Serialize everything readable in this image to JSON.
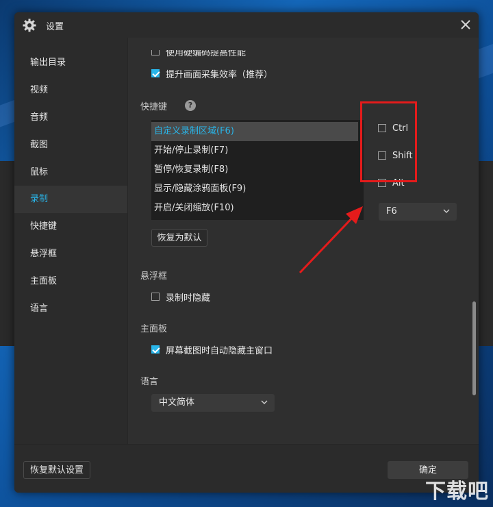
{
  "window": {
    "title": "设置",
    "close_icon": "close-icon",
    "title_icon": "gear-icon"
  },
  "sidebar": {
    "items": [
      {
        "label": "输出目录",
        "active": false
      },
      {
        "label": "视频",
        "active": false
      },
      {
        "label": "音频",
        "active": false
      },
      {
        "label": "截图",
        "active": false
      },
      {
        "label": "鼠标",
        "active": false
      },
      {
        "label": "录制",
        "active": true
      },
      {
        "label": "快捷键",
        "active": false
      },
      {
        "label": "悬浮框",
        "active": false
      },
      {
        "label": "主面板",
        "active": false
      },
      {
        "label": "语言",
        "active": false
      }
    ]
  },
  "recording": {
    "hw_encode_label": "使用硬编码提高性能",
    "hw_encode_checked": false,
    "capture_eff_label": "提升画面采集效率（推荐）",
    "capture_eff_checked": true
  },
  "hotkeys": {
    "section_title": "快捷键",
    "help_icon": "?",
    "items": [
      {
        "label": "自定义录制区域(F6)",
        "selected": true
      },
      {
        "label": "开始/停止录制(F7)",
        "selected": false
      },
      {
        "label": "暂停/恢复录制(F8)",
        "selected": false
      },
      {
        "label": "显示/隐藏涂鸦面板(F9)",
        "selected": false
      },
      {
        "label": "开启/关闭缩放(F10)",
        "selected": false
      }
    ],
    "modifiers": [
      {
        "label": "Ctrl",
        "checked": false
      },
      {
        "label": "Shift",
        "checked": false
      },
      {
        "label": "Alt",
        "checked": false
      }
    ],
    "key_value": "F6",
    "reset_label": "恢复为默认"
  },
  "floating": {
    "section_title": "悬浮框",
    "hide_label": "录制时隐藏",
    "hide_checked": false
  },
  "main_panel": {
    "section_title": "主面板",
    "auto_hide_label": "屏幕截图时自动隐藏主窗口",
    "auto_hide_checked": true
  },
  "language": {
    "section_title": "语言",
    "value": "中文简体"
  },
  "footer": {
    "reset_all_label": "恢复默认设置",
    "ok_label": "确定"
  },
  "colors": {
    "accent": "#29b6ea",
    "highlight": "#e41b1b"
  },
  "watermark": "下载吧"
}
